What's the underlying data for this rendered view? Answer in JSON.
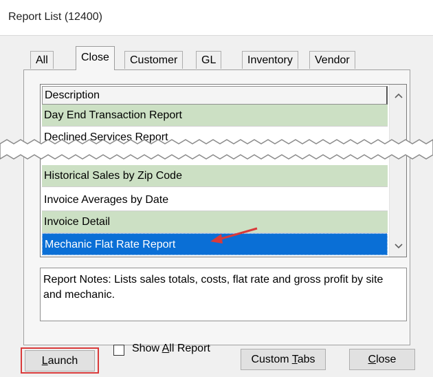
{
  "window": {
    "title": "Report List (12400)"
  },
  "tabs": [
    {
      "label": "All"
    },
    {
      "label": "Close",
      "active": true
    },
    {
      "label": "Customer"
    },
    {
      "label": "GL"
    },
    {
      "label": "Inventory"
    },
    {
      "label": "Vendor"
    }
  ],
  "list": {
    "header": "Description",
    "rows_top": [
      {
        "label": "Day End Transaction Report",
        "style": "green"
      },
      {
        "label": "Declined Services Report",
        "style": "white"
      }
    ],
    "rows_bottom": [
      {
        "label": "Historical Sales by Zip Code",
        "style": "green"
      },
      {
        "label": "Invoice Averages by Date",
        "style": "white"
      },
      {
        "label": "Invoice Detail",
        "style": "green"
      },
      {
        "label": "Mechanic Flat Rate Report",
        "style": "selected"
      }
    ],
    "selected_label": "Mechanic Flat Rate Report"
  },
  "notes": {
    "text": "Report Notes:  Lists sales totals, costs, flat rate and gross profit by site and mechanic."
  },
  "buttons": {
    "launch": {
      "prefix": "L",
      "rest": "aunch"
    },
    "show_all": {
      "pre": "Show ",
      "u": "A",
      "post": "ll Report"
    },
    "custom_tabs": {
      "pre": "Custom ",
      "u": "T",
      "post": "abs"
    },
    "close": {
      "u": "C",
      "rest": "lose"
    }
  },
  "colors": {
    "row_green": "#cce0c4",
    "selected_blue": "#0a6fd6",
    "annotation_red": "#d93a3a"
  },
  "icons": [
    "scroll-up-icon",
    "scroll-down-icon",
    "annotation-arrow-icon"
  ]
}
